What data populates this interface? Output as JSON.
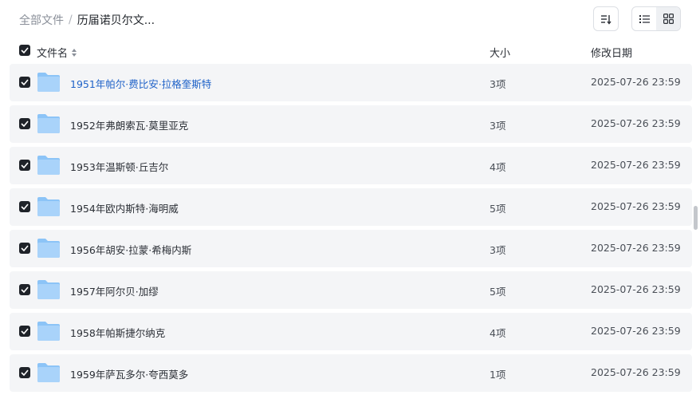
{
  "breadcrumb": {
    "root": "全部文件",
    "separator": "/",
    "current": "历届诺贝尔文..."
  },
  "toolbar": {
    "sort_icon": "sort-icon",
    "list_icon": "list-view-icon",
    "grid_icon": "grid-view-icon",
    "active_view": "list"
  },
  "columns": {
    "name": "文件名",
    "size": "大小",
    "modified": "修改日期"
  },
  "files": [
    {
      "name": "1951年帕尔·费比安·拉格奎斯特",
      "count": "3项",
      "modified": "2025-07-26 23:59",
      "checked": true,
      "highlighted": true
    },
    {
      "name": "1952年弗朗索瓦·莫里亚克",
      "count": "3项",
      "modified": "2025-07-26 23:59",
      "checked": true
    },
    {
      "name": "1953年温斯顿·丘吉尔",
      "count": "4项",
      "modified": "2025-07-26 23:59",
      "checked": true
    },
    {
      "name": "1954年欧内斯特·海明威",
      "count": "5项",
      "modified": "2025-07-26 23:59",
      "checked": true
    },
    {
      "name": "1956年胡安·拉蒙·希梅内斯",
      "count": "3项",
      "modified": "2025-07-26 23:59",
      "checked": true
    },
    {
      "name": "1957年阿尔贝·加缪",
      "count": "5项",
      "modified": "2025-07-26 23:59",
      "checked": true
    },
    {
      "name": "1958年帕斯捷尔纳克",
      "count": "4项",
      "modified": "2025-07-26 23:59",
      "checked": true
    },
    {
      "name": "1959年萨瓦多尔·夸西莫多",
      "count": "1项",
      "modified": "2025-07-26 23:59",
      "checked": true
    }
  ],
  "colors": {
    "accent_link": "#1f62c8",
    "row_bg": "#f4f5f7",
    "checkbox": "#1f2329",
    "folder": "#7ab8f5"
  }
}
